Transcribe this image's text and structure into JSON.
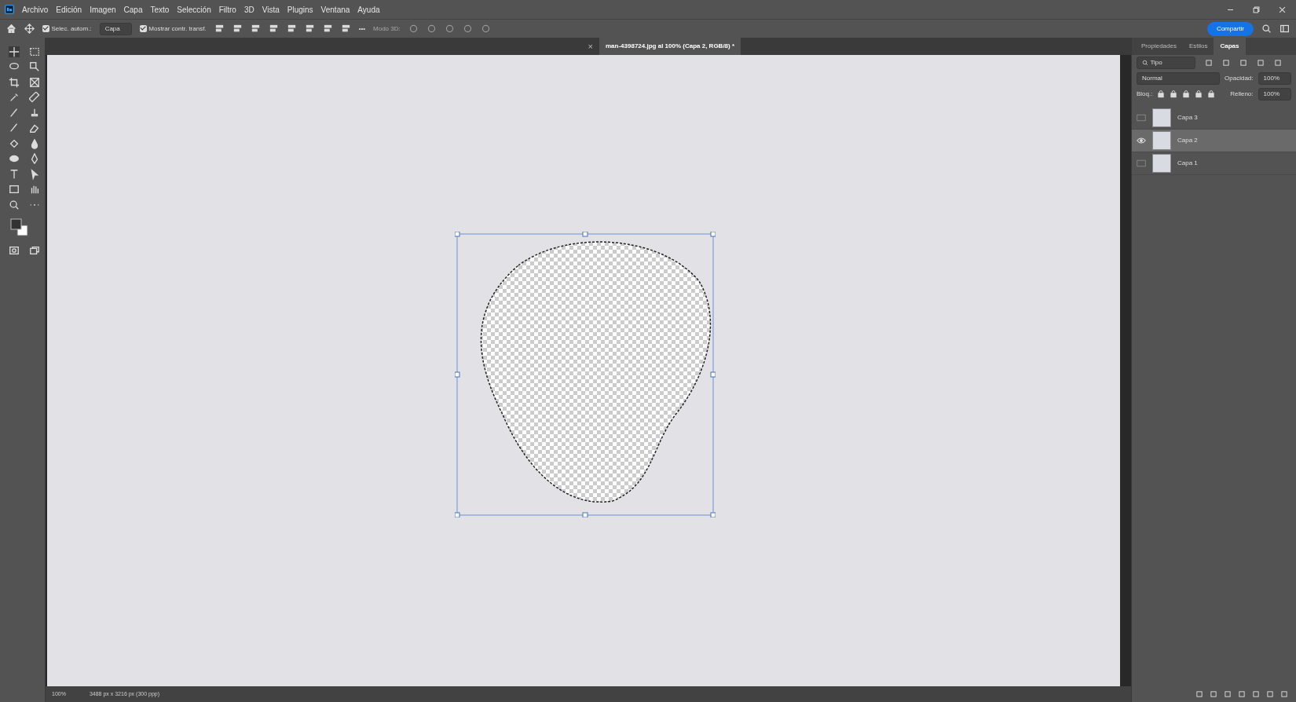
{
  "menu_bar": {
    "items": [
      "Archivo",
      "Edición",
      "Imagen",
      "Capa",
      "Texto",
      "Selección",
      "Filtro",
      "3D",
      "Vista",
      "Plugins",
      "Ventana",
      "Ayuda"
    ]
  },
  "options_bar": {
    "auto_select": {
      "label": "Selec. autom.:",
      "checked": true
    },
    "auto_select_target": "Capa",
    "show_transform": {
      "label": "Mostrar contr. transf.",
      "checked": true
    },
    "mode_3d": {
      "label": "Modo 3D:",
      "disabled": true
    },
    "more": "•••",
    "share_button": "Compartir"
  },
  "document_tabs": [
    {
      "selected": false,
      "close": "×"
    },
    {
      "title": "man-4398724.jpg al 100% (Capa 2, RGB/8) *",
      "selected": true
    }
  ],
  "panel": {
    "tabs": [
      {
        "label": "Propiedades",
        "selected": false
      },
      {
        "label": "Estilos",
        "selected": false
      },
      {
        "label": "Capas",
        "selected": true
      }
    ],
    "filter": "Tipo",
    "blend_mode": "Normal",
    "opacity_label": "Opacidad:",
    "opacity": "100%",
    "lock_label": "Bloq.:",
    "fill_label": "Relleno:",
    "fill": "100%",
    "layers": [
      {
        "name": "Capa 3",
        "visible": false,
        "selected": false
      },
      {
        "name": "Capa 2",
        "visible": true,
        "selected": true
      },
      {
        "name": "Capa 1",
        "visible": false,
        "selected": false
      }
    ]
  },
  "status_bar": {
    "zoom": "100%",
    "document_size": "3488 px x 3216 px (300 ppp)"
  }
}
